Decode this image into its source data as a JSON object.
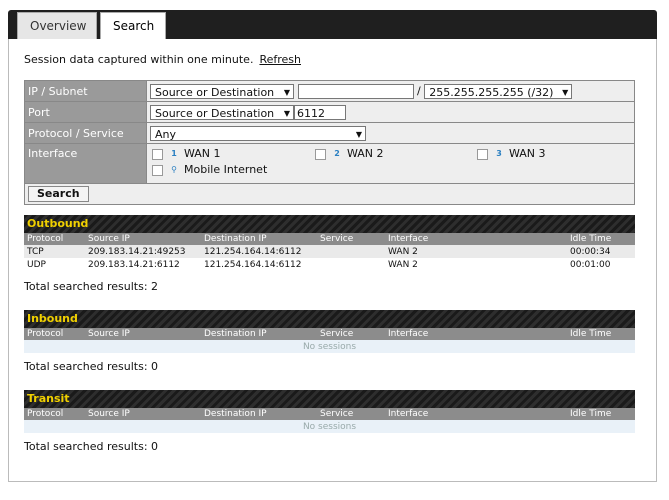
{
  "tabs": [
    {
      "label": "Overview",
      "active": false
    },
    {
      "label": "Search",
      "active": true
    }
  ],
  "notice": {
    "text": "Session data captured within one minute.",
    "refresh_label": "Refresh"
  },
  "form": {
    "ip_label": "IP / Subnet",
    "ip_mode": "Source or Destination",
    "ip_value": "",
    "ip_mask": "255.255.255.255 (/32)",
    "port_label": "Port",
    "port_mode": "Source or Destination",
    "port_value": "6112",
    "protocol_label": "Protocol / Service",
    "protocol_value": "Any",
    "interface_label": "Interface",
    "interfaces": [
      {
        "num": "1",
        "label": "WAN 1"
      },
      {
        "num": "2",
        "label": "WAN 2"
      },
      {
        "num": "3",
        "label": "WAN 3"
      },
      {
        "num": "",
        "label": "Mobile Internet"
      }
    ],
    "search_label": "Search"
  },
  "columns": [
    "Protocol",
    "Source IP",
    "Destination IP",
    "Service",
    "Interface",
    "Idle Time"
  ],
  "outbound": {
    "title": "Outbound",
    "rows": [
      {
        "protocol": "TCP",
        "source": "209.183.14.21:49253",
        "dest": "121.254.164.14:6112",
        "service": "",
        "iface": "WAN 2",
        "idle": "00:00:34"
      },
      {
        "protocol": "UDP",
        "source": "209.183.14.21:6112",
        "dest": "121.254.164.14:6112",
        "service": "",
        "iface": "WAN 2",
        "idle": "00:01:00"
      }
    ],
    "total": "Total searched results: 2"
  },
  "inbound": {
    "title": "Inbound",
    "empty": "No sessions",
    "total": "Total searched results: 0"
  },
  "transit": {
    "title": "Transit",
    "empty": "No sessions",
    "total": "Total searched results: 0"
  },
  "colors": {
    "header_bar": "#1f1f1f",
    "section_title": "#f0d000",
    "label_bg": "#9a9a9a"
  }
}
